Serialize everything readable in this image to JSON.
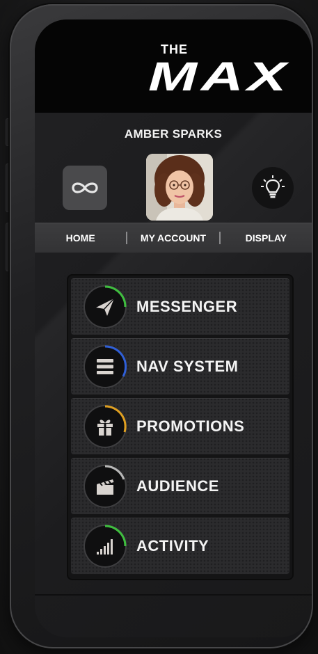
{
  "app": {
    "logo_small": "THE",
    "logo_large": "MAX"
  },
  "profile": {
    "name": "AMBER SPARKS"
  },
  "icons": {
    "left_button": "infinity-icon",
    "right_button": "lightbulb-icon"
  },
  "nav": {
    "items": [
      {
        "label": "HOME"
      },
      {
        "label": "MY ACCOUNT"
      },
      {
        "label": "DISPLAY"
      }
    ]
  },
  "menu": {
    "items": [
      {
        "label": "MESSENGER",
        "icon": "paper-plane-icon",
        "ring_color": "#3fbf3f"
      },
      {
        "label": "NAV SYSTEM",
        "icon": "menu-lines-icon",
        "ring_color": "#2f5fd8"
      },
      {
        "label": "PROMOTIONS",
        "icon": "gift-icon",
        "ring_color": "#e0a020"
      },
      {
        "label": "AUDIENCE",
        "icon": "clapperboard-icon",
        "ring_color": "#b8b8b8"
      },
      {
        "label": "ACTIVITY",
        "icon": "signal-bars-icon",
        "ring_color": "#3fbf3f"
      }
    ]
  }
}
